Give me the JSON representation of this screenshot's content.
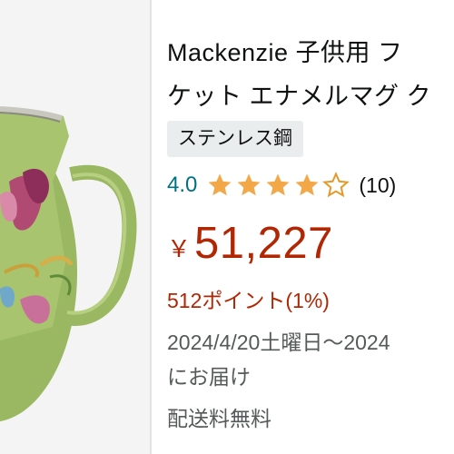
{
  "product": {
    "title_line1": "Mackenzie 子供用 フ",
    "title_line2": "ケット エナメルマグ ク",
    "variant": "ステンレス鋼"
  },
  "rating": {
    "value": "4.0",
    "stars": 4,
    "max_stars": 5,
    "count": "(10)",
    "star_color": "#f3a847"
  },
  "price": {
    "symbol": "￥",
    "amount": "51,227",
    "color": "#b12704"
  },
  "points": {
    "text": "512ポイント(1%)"
  },
  "delivery": {
    "date_text": "2024/4/20土曜日～2024",
    "suffix": "にお届け"
  },
  "shipping": {
    "text": "配送料無料"
  },
  "icons": {
    "star_full": "star-icon",
    "star_empty": "star-outline-icon"
  }
}
